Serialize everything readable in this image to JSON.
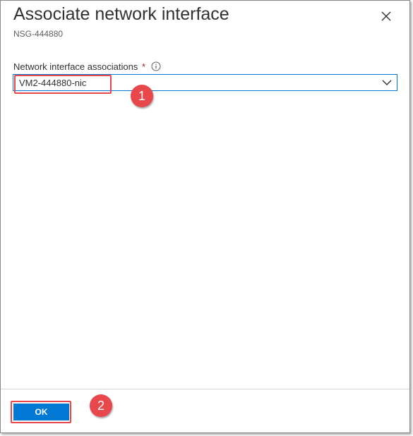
{
  "panel": {
    "title": "Associate network interface",
    "subtitle": "NSG-444880"
  },
  "field": {
    "label": "Network interface associations",
    "required_mark": "*",
    "selected_value": "VM2-444880-nic"
  },
  "footer": {
    "ok_label": "OK"
  },
  "annotations": {
    "step_1": "1",
    "step_2": "2"
  },
  "icons": {
    "close": "close-icon",
    "info": "info-icon",
    "dropdown": "chevron-down-icon"
  },
  "colors": {
    "accent": "#0078d4",
    "required": "#a4262c",
    "annotation": "#e8474c"
  }
}
